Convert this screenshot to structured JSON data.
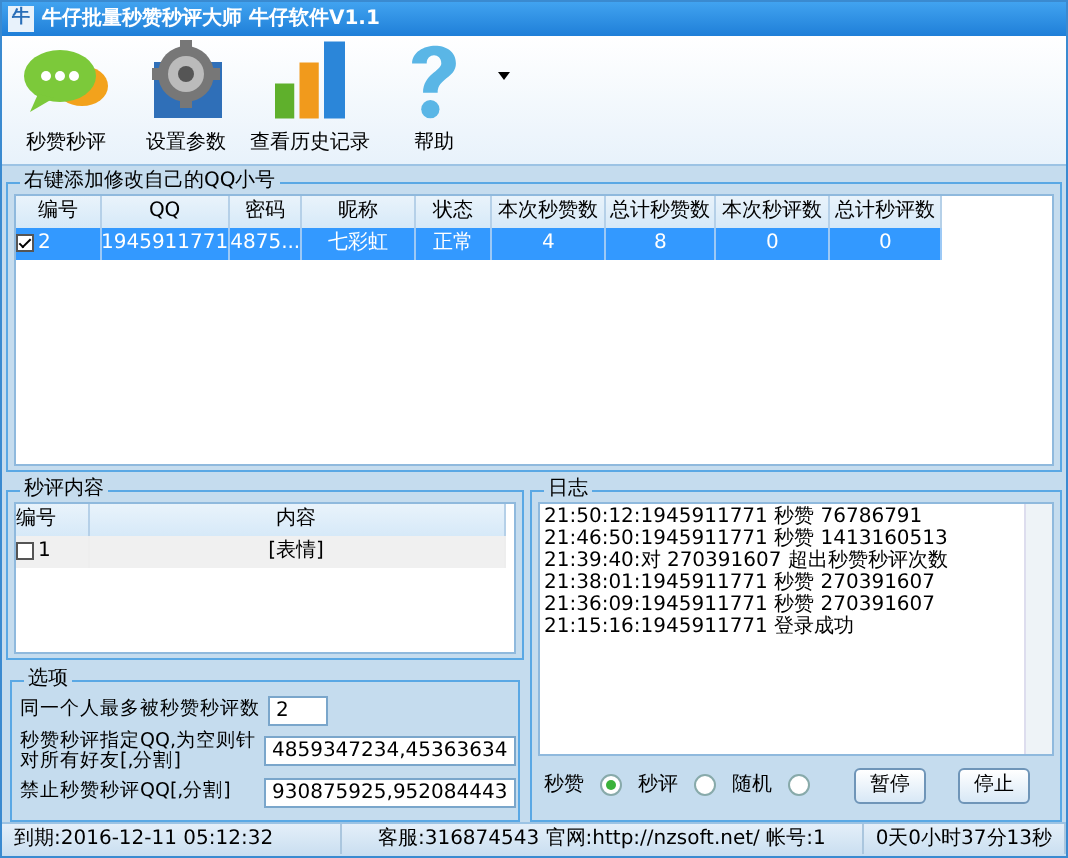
{
  "window": {
    "title": "牛仔批量秒赞秒评大师  牛仔软件V1.1",
    "app_icon": "牛"
  },
  "toolbar": [
    {
      "label": "秒赞秒评",
      "kind": "chat"
    },
    {
      "label": "设置参数",
      "kind": "gear"
    },
    {
      "label": "查看历史记录",
      "kind": "chart"
    },
    {
      "label": "帮助",
      "kind": "help"
    }
  ],
  "accounts": {
    "title": "右键添加修改自己的QQ小号",
    "columns": [
      "编号",
      "QQ",
      "密码",
      "昵称",
      "状态",
      "本次秒赞数",
      "总计秒赞数",
      "本次秒评数",
      "总计秒评数"
    ],
    "rows": [
      {
        "cells": [
          "2",
          "1945911771",
          "4875...",
          "七彩虹",
          "正常",
          "4",
          "8",
          "0",
          "0"
        ],
        "checked": true,
        "selected": true
      }
    ]
  },
  "comments": {
    "title": "秒评内容",
    "columns": [
      "编号",
      "内容"
    ],
    "rows": [
      {
        "number": "1",
        "content": "[表情]",
        "checked": false
      }
    ]
  },
  "log": {
    "title": "日志",
    "lines": [
      "21:50:12:1945911771 秒赞 76786791",
      "21:46:50:1945911771 秒赞 1413160513",
      "21:39:40:对 270391607 超出秒赞秒评次数",
      "21:38:01:1945911771 秒赞 270391607",
      "21:36:09:1945911771 秒赞 270391607",
      "21:15:16:1945911771 登录成功"
    ]
  },
  "options": {
    "title": "选项",
    "fields": [
      {
        "label": "同一个人最多被秒赞秒评数",
        "value": "2",
        "kind": "short"
      },
      {
        "label": "秒赞秒评指定QQ,为空则针对所有好友[,分割]",
        "value": "4859347234,45363634",
        "kind": "long"
      },
      {
        "label": "禁止秒赞秒评QQ[,分割]",
        "value": "930875925,952084443",
        "kind": "long"
      }
    ]
  },
  "modes": [
    {
      "label": "秒赞",
      "selected": true
    },
    {
      "label": "秒评",
      "selected": false
    },
    {
      "label": "随机",
      "selected": false
    }
  ],
  "buttons": [
    "暂停",
    "停止"
  ],
  "status_bar": [
    "到期:2016-12-11 05:12:32",
    "客服:316874543 官网:http://nzsoft.net/ 帐号:1",
    "0天0小时37分13秒"
  ]
}
